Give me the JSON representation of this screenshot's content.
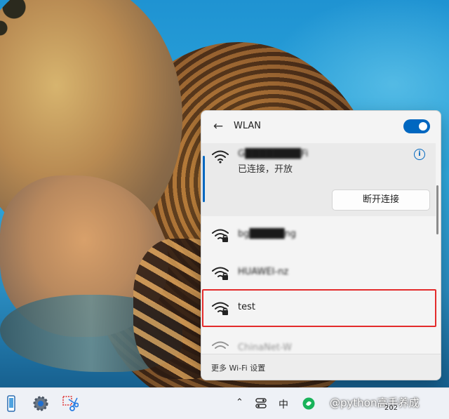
{
  "flyout": {
    "title": "WLAN",
    "wifi_toggle_on": true,
    "accent_color": "#0067c0",
    "connected_network": {
      "name": "G████████Fi",
      "status": "已连接，开放",
      "disconnect_label": "断开连接",
      "info_glyph": "i"
    },
    "networks": [
      {
        "name": "bg█████ng",
        "secured": true,
        "blurred": true
      },
      {
        "name": "HUAWEI-nz",
        "secured": true,
        "blurred": true
      },
      {
        "name": "test",
        "secured": true,
        "blurred": false,
        "highlighted": true
      },
      {
        "name": "ChinaNet-W",
        "secured": false,
        "blurred": true
      }
    ],
    "footer_link": "更多 Wi-Fi 设置",
    "highlight_color": "#e32b2b"
  },
  "taskbar": {
    "icons": [
      "phone-icon",
      "settings-gear-icon",
      "snipping-tool-icon",
      "chevron-up-icon",
      "network-status-icon"
    ],
    "ime_label": "中",
    "watermark": "@python高手养成",
    "clock_partial": "202"
  }
}
